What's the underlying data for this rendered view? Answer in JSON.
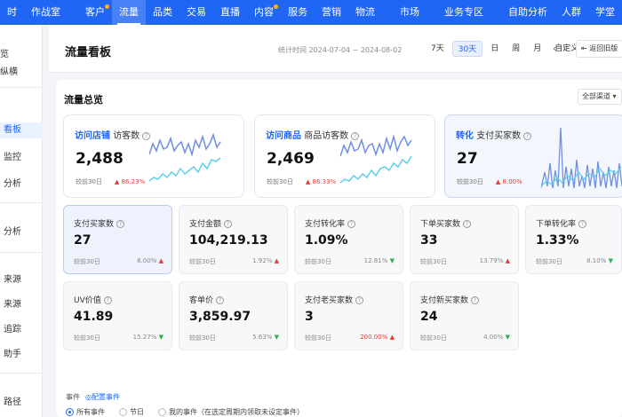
{
  "nav": {
    "items": [
      "时",
      "作战室",
      "客户",
      "流量",
      "品类",
      "交易",
      "直播",
      "内容",
      "服务",
      "营销",
      "物流",
      "市场",
      "业务专区",
      "自助分析",
      "人群",
      "学堂"
    ],
    "active_index": 3,
    "dot_indices": [
      2,
      7
    ]
  },
  "sidebar": {
    "items": [
      "览",
      "纵横",
      "看板",
      "监控",
      "分析",
      "分析",
      "来源",
      "来源",
      "追踪",
      "助手",
      "路径"
    ],
    "active_index": 2
  },
  "header": {
    "title": "流量看板",
    "stat_time": "统计时间 2024-07-04 ~ 2024-08-02",
    "periods": [
      "7天",
      "30天",
      "日",
      "周",
      "月",
      "自定义"
    ],
    "selected_period": "30天",
    "prev_label": "‹",
    "next_label": "›",
    "back_label": "⇤ 返回旧版"
  },
  "overview": {
    "title": "流量总览",
    "dropdown_label": "全部渠道 ▾",
    "cards": [
      {
        "title": "访问店铺",
        "subtitle": "访客数",
        "value": "2,488",
        "compare": "较前30日",
        "change": "▲ 86.23%"
      },
      {
        "title": "访问商品",
        "subtitle": "商品访客数",
        "value": "2,469",
        "compare": "较前30日",
        "change": "▲ 86.33%"
      },
      {
        "title": "转化",
        "subtitle": "支付买家数",
        "value": "27",
        "compare": "较前30日",
        "change": "▲ 8.00%"
      }
    ],
    "metrics": [
      {
        "label": "支付买家数",
        "value": "27",
        "compare": "较前30日",
        "change": "8.00%",
        "dir": "up"
      },
      {
        "label": "支付金额",
        "value": "104,219.13",
        "compare": "较前30日",
        "change": "1.92%",
        "dir": "up"
      },
      {
        "label": "支付转化率",
        "value": "1.09%",
        "compare": "较前30日",
        "change": "12.81%",
        "dir": "down"
      },
      {
        "label": "下单买家数",
        "value": "33",
        "compare": "较前30日",
        "change": "13.79%",
        "dir": "up"
      },
      {
        "label": "下单转化率",
        "value": "1.33%",
        "compare": "较前30日",
        "change": "8.10%",
        "dir": "down"
      },
      {
        "label": "UV价值",
        "value": "41.89",
        "compare": "较前30日",
        "change": "15.27%",
        "dir": "down"
      },
      {
        "label": "客单价",
        "value": "3,859.97",
        "compare": "较前30日",
        "change": "5.63%",
        "dir": "down"
      },
      {
        "label": "支付老买家数",
        "value": "3",
        "compare": "较前30日",
        "change": "200.00%",
        "dir": "up"
      },
      {
        "label": "支付新买家数",
        "value": "24",
        "compare": "较前30日",
        "change": "4.00%",
        "dir": "down"
      }
    ]
  },
  "events": {
    "label": "事件",
    "link": "◎配置事件",
    "options": [
      "所有事件",
      "节日",
      "我的事件（在选定周期内领取未设定事件）"
    ],
    "selected": "所有事件"
  },
  "colors": {
    "primary": "#1f66f5",
    "up": "#e53935",
    "down": "#2bb24c",
    "spark_dark": "#6f8fe0",
    "spark_light": "#5ecfe8"
  }
}
